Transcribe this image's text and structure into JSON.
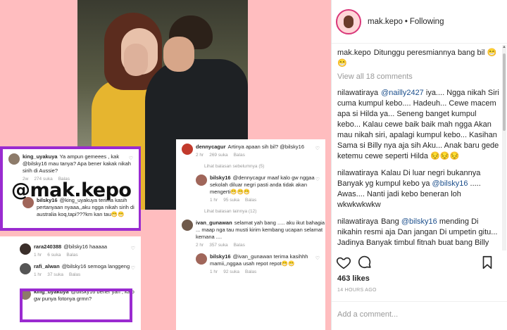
{
  "collage": {
    "watermark": "@mak.kepo",
    "card_a": {
      "c1": {
        "user": "king_uyakuya",
        "text": "Ya ampun gemeees , kak @bilsky16 mau tanya? Apa bener kakak nikah sirih di Aussie?",
        "time": "2w",
        "likes": "274 suka",
        "reply": "Balas"
      },
      "c2": {
        "user": "bilsky16",
        "text": "@king_uyakuya terima kasih pertanyaan nyaaa,,aku ngga nikah sirih di australia koq,tapi???km kan tau😁😁",
        "time": "1 hr",
        "likes": "",
        "reply": ""
      }
    },
    "card_b": {
      "c1": {
        "user": "dennycagur",
        "text": "Artinya apaan sih bil? @bilsky16",
        "time": "2 hr",
        "likes": "269 suka",
        "reply": "Balas"
      },
      "div1": "Lihat balasan sebelumnya (5)",
      "c2": {
        "user": "bilsky16",
        "text": "@dennycagur maaf kalo gw nggaa sekolah diluar negri pasti anda tidak akan mengerti😁😁😁",
        "time": "1 hr",
        "likes": "95 suka",
        "reply": "Balas"
      },
      "div2": "Lihat balasan lainnya (12)",
      "c3": {
        "user": "ivan_gunawan",
        "text": "selamat yah bang ..... aku ikut bahagia ... maap nga tau musti kirim kembang ucapan selamat kemana ....",
        "time": "2 hr",
        "likes": "357 suka",
        "reply": "Balas"
      },
      "c4": {
        "user": "bilsky16",
        "text": "@ivan_gunawan terima kasihhh mamii,,nggaa usah repot repot😁😁",
        "time": "1 hr",
        "likes": "92 suka",
        "reply": "Balas"
      }
    },
    "card_c": {
      "c1": {
        "user": "rara240388",
        "text": "@bilsky16 haaaaa",
        "time": "1 hr",
        "likes": "6 suka",
        "reply": "Balas"
      },
      "c2": {
        "user": "rafi_alwan",
        "text": "@bilsky16 semoga langgeng",
        "time": "1 hr",
        "likes": "37 suka",
        "reply": "Balas"
      },
      "c3": {
        "user": "king_uyakuya",
        "text": "@bilsky16 bener yah , kalo gw punya fotonya grmn?",
        "time": "",
        "likes": "",
        "reply": ""
      }
    }
  },
  "post": {
    "username": "mak.kepo",
    "dot": "•",
    "follow_state": "Following",
    "caption_user": "mak.kepo",
    "caption_text": "Ditunggu peresmiannya bang bil 😁😁",
    "view_all": "View all 18 comments",
    "comments": [
      {
        "user": "nilawatiraya",
        "mention": "@nailly2427",
        "text": "iya.... Ngga nikah Siri cuma kumpul kebo.... Hadeuh... Cewe macem apa si Hilda ya... Seneng banget kumpul kebo... Kalau cewe baik baik mah ngga Akan mau nikah siri, apalagi kumpul kebo... Kasihan Sama si Billy nya aja sih Aku... Anak baru gede ketemu cewe seperti Hilda 😔😔😔"
      },
      {
        "user": "nilawatiraya",
        "mention": "",
        "text": "Kalau Di luar negri bukannya Banyak yg kumpul kebo ya",
        "mention2": "@bilsky16",
        "text2": "..... Awas.... Nanti jadi kebo beneran loh wkwkwkwkw"
      },
      {
        "user": "nilawatiraya",
        "mention": "",
        "text": "Bang",
        "mention2": "@bilsky16",
        "text2": "mending Di nikahin resmi aja Dan jangan Di umpetin gitu... Jadinya Banyak timbul fitnah buat bang Billy"
      }
    ],
    "likes": "463 likes",
    "time_ago": "14 HOURS AGO",
    "add_comment_placeholder": "Add a comment..."
  },
  "colors": {
    "highlight_box": "#9a2bd0",
    "collage_bg": "#ffbdbf",
    "mention": "#1c4f8c"
  },
  "icons": [
    "heart-icon",
    "comment-icon",
    "bookmark-icon",
    "scroll-up-arrow-icon"
  ]
}
